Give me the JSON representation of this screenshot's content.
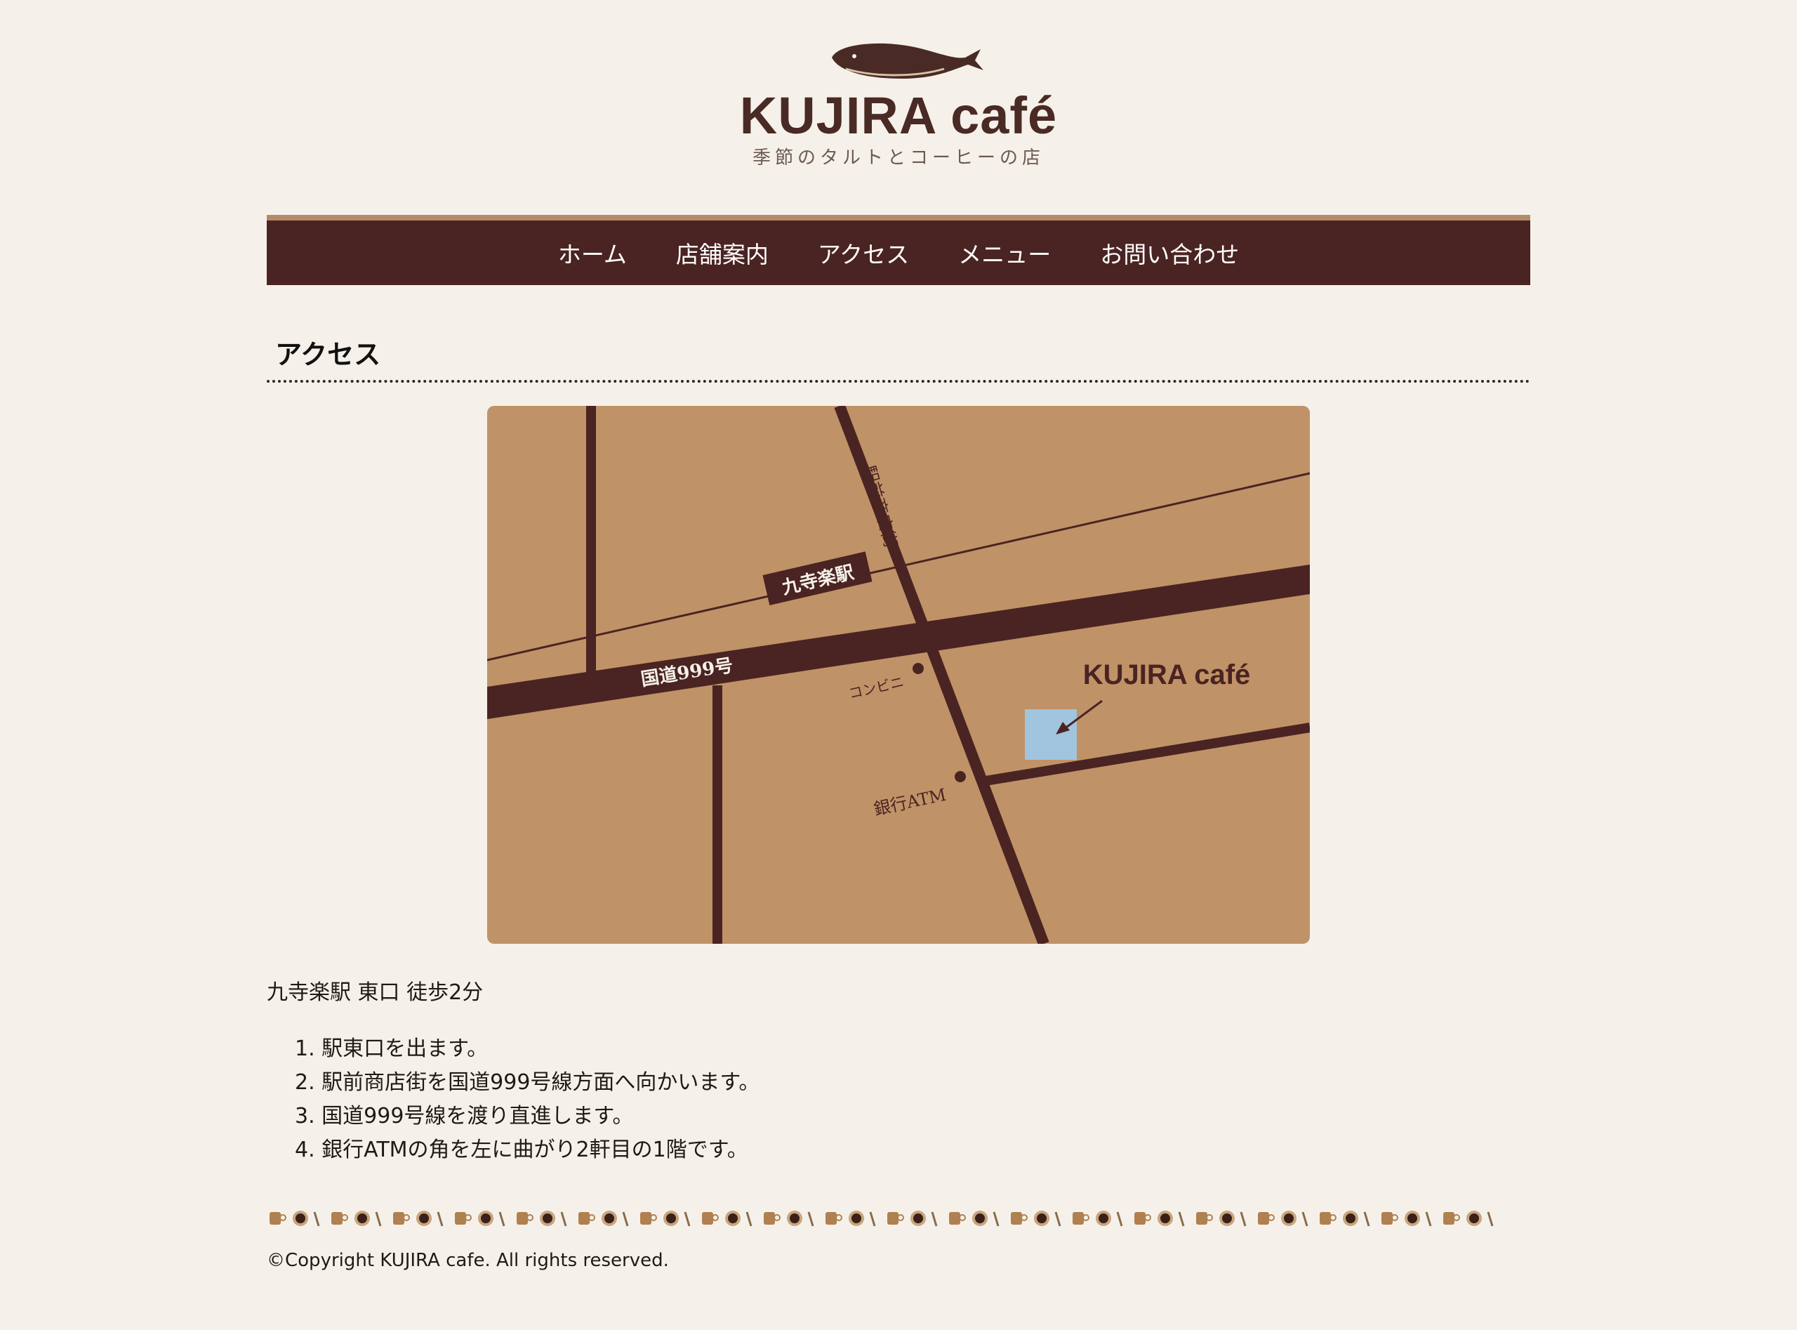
{
  "header": {
    "logo_title": "KUJIRA café",
    "logo_subtitle": "季節のタルトとコーヒーの店"
  },
  "nav": {
    "items": [
      {
        "label": "ホーム"
      },
      {
        "label": "店舗案内"
      },
      {
        "label": "アクセス"
      },
      {
        "label": "メニュー"
      },
      {
        "label": "お問い合わせ"
      }
    ]
  },
  "main": {
    "section_title": "アクセス",
    "map": {
      "station": "九寺楽駅",
      "shopping_street": "駅前商店街",
      "route": "国道999号",
      "convenience_store": "コンビニ",
      "bank": "銀行ATM",
      "cafe": "KUJIRA café"
    },
    "station_line": "九寺楽駅 東口 徒歩2分",
    "steps": [
      "1. 駅東口を出ます。",
      "2. 駅前商店街を国道999号線方面へ向かいます。",
      "3. 国道999号線を渡り直進します。",
      "4. 銀行ATMの角を左に曲がり2軒目の1階です。"
    ]
  },
  "colors": {
    "background": "#f5f1ea",
    "nav_background": "#4a2422",
    "map_background": "#c09267",
    "road": "#4a2422",
    "cafe_marker": "#9fc7e6"
  },
  "footer": {
    "copyright": "©Copyright KUJIRA cafe. All rights reserved."
  }
}
